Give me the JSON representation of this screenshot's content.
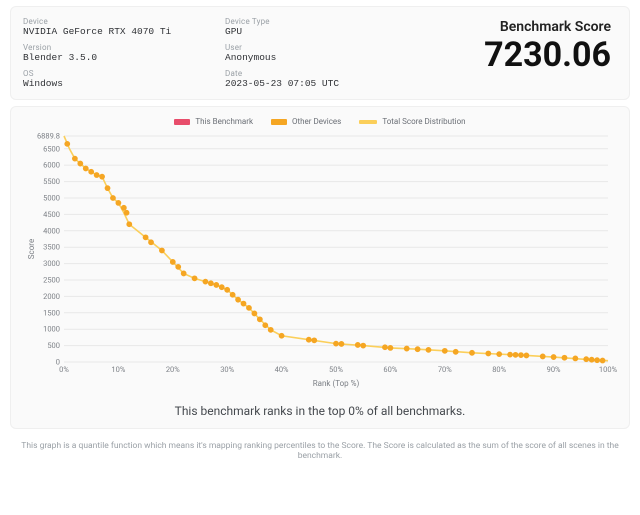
{
  "info": {
    "device_label": "Device",
    "device_value": "NVIDIA GeForce RTX 4070 Ti",
    "version_label": "Version",
    "version_value": "Blender 3.5.0",
    "os_label": "OS",
    "os_value": "Windows",
    "device_type_label": "Device Type",
    "device_type_value": "GPU",
    "user_label": "User",
    "user_value": "Anonymous",
    "date_label": "Date",
    "date_value": "2023-05-23 07:05 UTC"
  },
  "score": {
    "label": "Benchmark Score",
    "value": "7230.06"
  },
  "legend": {
    "this": "This Benchmark",
    "other": "Other Devices",
    "total": "Total Score Distribution"
  },
  "axes": {
    "xlabel": "Rank (Top %)",
    "ylabel": "Score"
  },
  "rank_line": "This benchmark ranks in the top 0% of all benchmarks.",
  "foot_note": "This graph is a quantile function which means it's mapping ranking percentiles to the Score. The Score is calculated as the sum of the score of all scenes in the benchmark.",
  "chart_data": {
    "type": "scatter",
    "title": "",
    "xlabel": "Rank (Top %)",
    "ylabel": "Score",
    "xlim": [
      0,
      100
    ],
    "ylim": [
      0,
      6889.8
    ],
    "xticks": [
      "0%",
      "10%",
      "20%",
      "30%",
      "40%",
      "50%",
      "60%",
      "70%",
      "80%",
      "90%",
      "100%"
    ],
    "yticks": [
      0,
      500,
      1000,
      1500,
      2000,
      2500,
      3000,
      3500,
      4000,
      4500,
      5000,
      5500,
      6000,
      6500,
      6889.8
    ],
    "series": [
      {
        "name": "Total Score Distribution",
        "kind": "line",
        "x": [
          0,
          0.5,
          1,
          2,
          3,
          4,
          5,
          6,
          7,
          8,
          9,
          10,
          11,
          12,
          15,
          18,
          20,
          22,
          24,
          26,
          28,
          30,
          32,
          34,
          36,
          38,
          40,
          45,
          50,
          55,
          60,
          65,
          70,
          75,
          80,
          85,
          90,
          95,
          100
        ],
        "y": [
          6889.8,
          6700,
          6500,
          6200,
          6050,
          5900,
          5800,
          5700,
          5650,
          5300,
          5000,
          4850,
          4550,
          4200,
          3800,
          3400,
          3050,
          2700,
          2550,
          2450,
          2350,
          2200,
          1900,
          1650,
          1300,
          980,
          800,
          680,
          560,
          500,
          430,
          390,
          340,
          280,
          240,
          200,
          150,
          90,
          40
        ]
      },
      {
        "name": "Other Devices",
        "kind": "scatter",
        "x": [
          0.6,
          2,
          3,
          4,
          5,
          6,
          7,
          8,
          9,
          10,
          11,
          11.5,
          12,
          15,
          16,
          18,
          20,
          21,
          22,
          24,
          26,
          27,
          28,
          29,
          30,
          31,
          32,
          33,
          34,
          35,
          36,
          37,
          38,
          40,
          45,
          46,
          50,
          51,
          54,
          55,
          59,
          60,
          63,
          65,
          67,
          70,
          72,
          75,
          78,
          80,
          82,
          83,
          84,
          85,
          88,
          90,
          92,
          94,
          96,
          97,
          98,
          99
        ],
        "y": [
          6650,
          6200,
          6050,
          5900,
          5800,
          5700,
          5650,
          5300,
          5000,
          4850,
          4700,
          4550,
          4200,
          3800,
          3650,
          3400,
          3050,
          2900,
          2700,
          2550,
          2450,
          2400,
          2350,
          2280,
          2200,
          2050,
          1900,
          1780,
          1650,
          1480,
          1300,
          1120,
          980,
          800,
          680,
          660,
          560,
          550,
          520,
          500,
          450,
          430,
          410,
          390,
          370,
          340,
          310,
          280,
          260,
          240,
          225,
          218,
          210,
          200,
          170,
          150,
          130,
          110,
          85,
          70,
          55,
          45
        ]
      }
    ]
  }
}
